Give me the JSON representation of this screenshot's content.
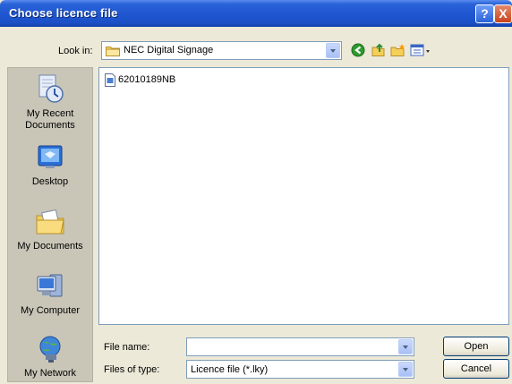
{
  "window": {
    "title": "Choose licence file",
    "help_label": "?",
    "close_label": "X"
  },
  "lookin": {
    "label": "Look in:",
    "value": "NEC Digital Signage"
  },
  "places": [
    {
      "label": "My Recent Documents",
      "icon": "recent-documents-icon"
    },
    {
      "label": "Desktop",
      "icon": "desktop-icon"
    },
    {
      "label": "My Documents",
      "icon": "my-documents-icon"
    },
    {
      "label": "My Computer",
      "icon": "my-computer-icon"
    },
    {
      "label": "My Network",
      "icon": "my-network-icon"
    }
  ],
  "files": [
    {
      "name": "62010189NB",
      "icon": "document-icon"
    }
  ],
  "filename": {
    "label": "File name:",
    "value": ""
  },
  "filetype": {
    "label": "Files of type:",
    "value": "Licence file (*.lky)"
  },
  "buttons": {
    "open": "Open",
    "cancel": "Cancel"
  },
  "colors": {
    "titlebar": "#1f56cf",
    "dialog_bg": "#ece9d8",
    "places_bg": "#c9c6b8",
    "input_border": "#7f9db9"
  }
}
